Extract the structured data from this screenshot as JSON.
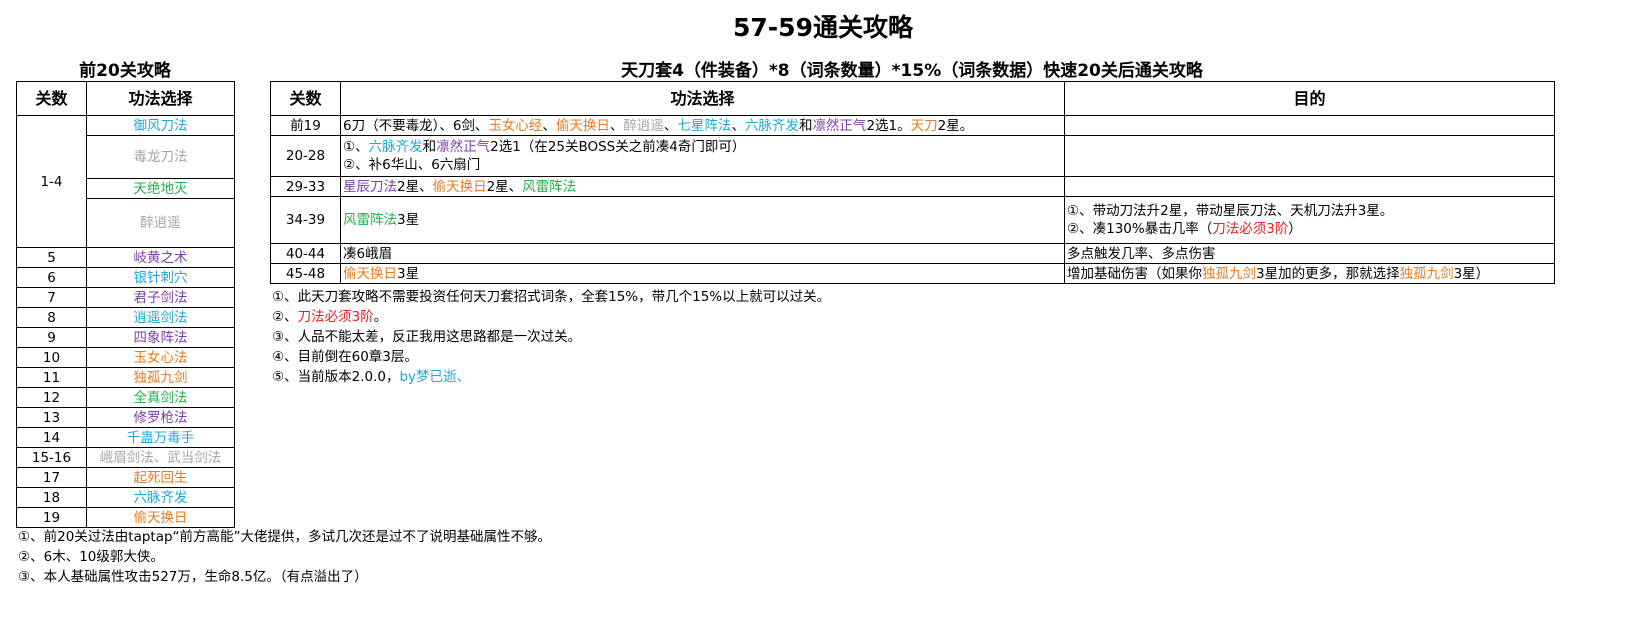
{
  "title": "57-59通关攻略",
  "left": {
    "heading": "前20关攻略",
    "col_level": "关数",
    "col_skill": "功法选择",
    "group_level": "1-4",
    "group_skills": [
      {
        "name": "御风刀法",
        "color": "blue"
      },
      {
        "name": "毒龙刀法",
        "color": "gray"
      },
      {
        "name": "天绝地灭",
        "color": "green"
      },
      {
        "name": "醉逍遥",
        "color": "gray"
      }
    ],
    "rows": [
      {
        "level": "5",
        "skill": "岐黄之术",
        "color": "purple"
      },
      {
        "level": "6",
        "skill": "银针刺穴",
        "color": "blue"
      },
      {
        "level": "7",
        "skill": "君子剑法",
        "color": "purple"
      },
      {
        "level": "8",
        "skill": "逍遥剑法",
        "color": "blue"
      },
      {
        "level": "9",
        "skill": "四象阵法",
        "color": "purple"
      },
      {
        "level": "10",
        "skill": "玉女心法",
        "color": "orange"
      },
      {
        "level": "11",
        "skill": "独孤九剑",
        "color": "orange"
      },
      {
        "level": "12",
        "skill": "全真剑法",
        "color": "green"
      },
      {
        "level": "13",
        "skill": "修罗枪法",
        "color": "purple"
      },
      {
        "level": "14",
        "skill": "千蛊万毒手",
        "color": "blue"
      },
      {
        "level": "15-16",
        "skill": "峨眉剑法、武当剑法",
        "color": "gray"
      },
      {
        "level": "17",
        "skill": "起死回生",
        "color": "orange"
      },
      {
        "level": "18",
        "skill": "六脉齐发",
        "color": "blue"
      },
      {
        "level": "19",
        "skill": "偷天换日",
        "color": "orange"
      }
    ],
    "notes": [
      "①、前20关过法由taptap“前方高能”大佬提供，多试几次还是过不了说明基础属性不够。",
      "②、6木、10级郭大侠。",
      "③、本人基础属性攻击527万，生命8.5亿。（有点溢出了）"
    ]
  },
  "right": {
    "heading": "天刀套4（件装备）*8（词条数量）*15%（词条数据）快速20关后通关攻略",
    "col_level": "关数",
    "col_skill": "功法选择",
    "col_goal": "目的",
    "r1": {
      "level": "前19",
      "s1": "6刀（不要毒龙）、6剑、",
      "s2": "玉女心经",
      "s3": "、",
      "s4": "偷天换日",
      "s5": "、",
      "s6": "醉逍遥",
      "s7": "、",
      "s8": "七星阵法",
      "s9": "、",
      "s10": "六脉齐发",
      "s11": "和",
      "s12": "凛然正气",
      "s13": "2选1。",
      "s14": "天刀",
      "s15": "2星。"
    },
    "r2": {
      "level": "20-28",
      "a1": "①、",
      "a2": "六脉齐发",
      "a3": "和",
      "a4": "凛然正气",
      "a5": "2选1（在25关BOSS关之前凑4奇门即可）",
      "b": "②、补6华山、6六扇门"
    },
    "r3": {
      "level": "29-33",
      "s1": "星辰刀法",
      "s2": "2星、",
      "s3": "偷天换日",
      "s4": "2星、",
      "s5": "风雷阵法"
    },
    "r4": {
      "level": "34-39",
      "s1": "风雷阵法",
      "s2": "3星",
      "g1": "①、带动刀法升2星，带动星辰刀法、天机刀法升3星。",
      "g2a": "②、凑130%暴击几率（",
      "g2b": "刀法必须3阶",
      "g2c": "）"
    },
    "r5": {
      "level": "40-44",
      "skill": "凑6峨眉",
      "goal": "多点触发几率、多点伤害"
    },
    "r6": {
      "level": "45-48",
      "s1": "偷天换日",
      "s2": "3星",
      "g1": "增加基础伤害（如果你",
      "g2": "独孤九剑",
      "g3": "3星加的更多，那就选择",
      "g4": "独孤九剑",
      "g5": "3星）"
    },
    "notes": {
      "n1": "①、此天刀套攻略不需要投资任何天刀套招式词条，全套15%，带几个15%以上就可以过关。",
      "n2a": "②、",
      "n2b": "刀法必须3阶",
      "n2c": "。",
      "n3": "③、人品不能太差，反正我用这思路都是一次过关。",
      "n4": "④、目前倒在60章3层。",
      "n5a": "⑤、当前版本2.0.0，",
      "n5b": "by梦已逝、"
    }
  },
  "colors": {
    "blue": "#1fa8d6",
    "gray": "#a6a6a6",
    "green": "#1fb14a",
    "purple": "#7b3fa8",
    "orange": "#ea7b22",
    "red": "#ec1c24"
  }
}
